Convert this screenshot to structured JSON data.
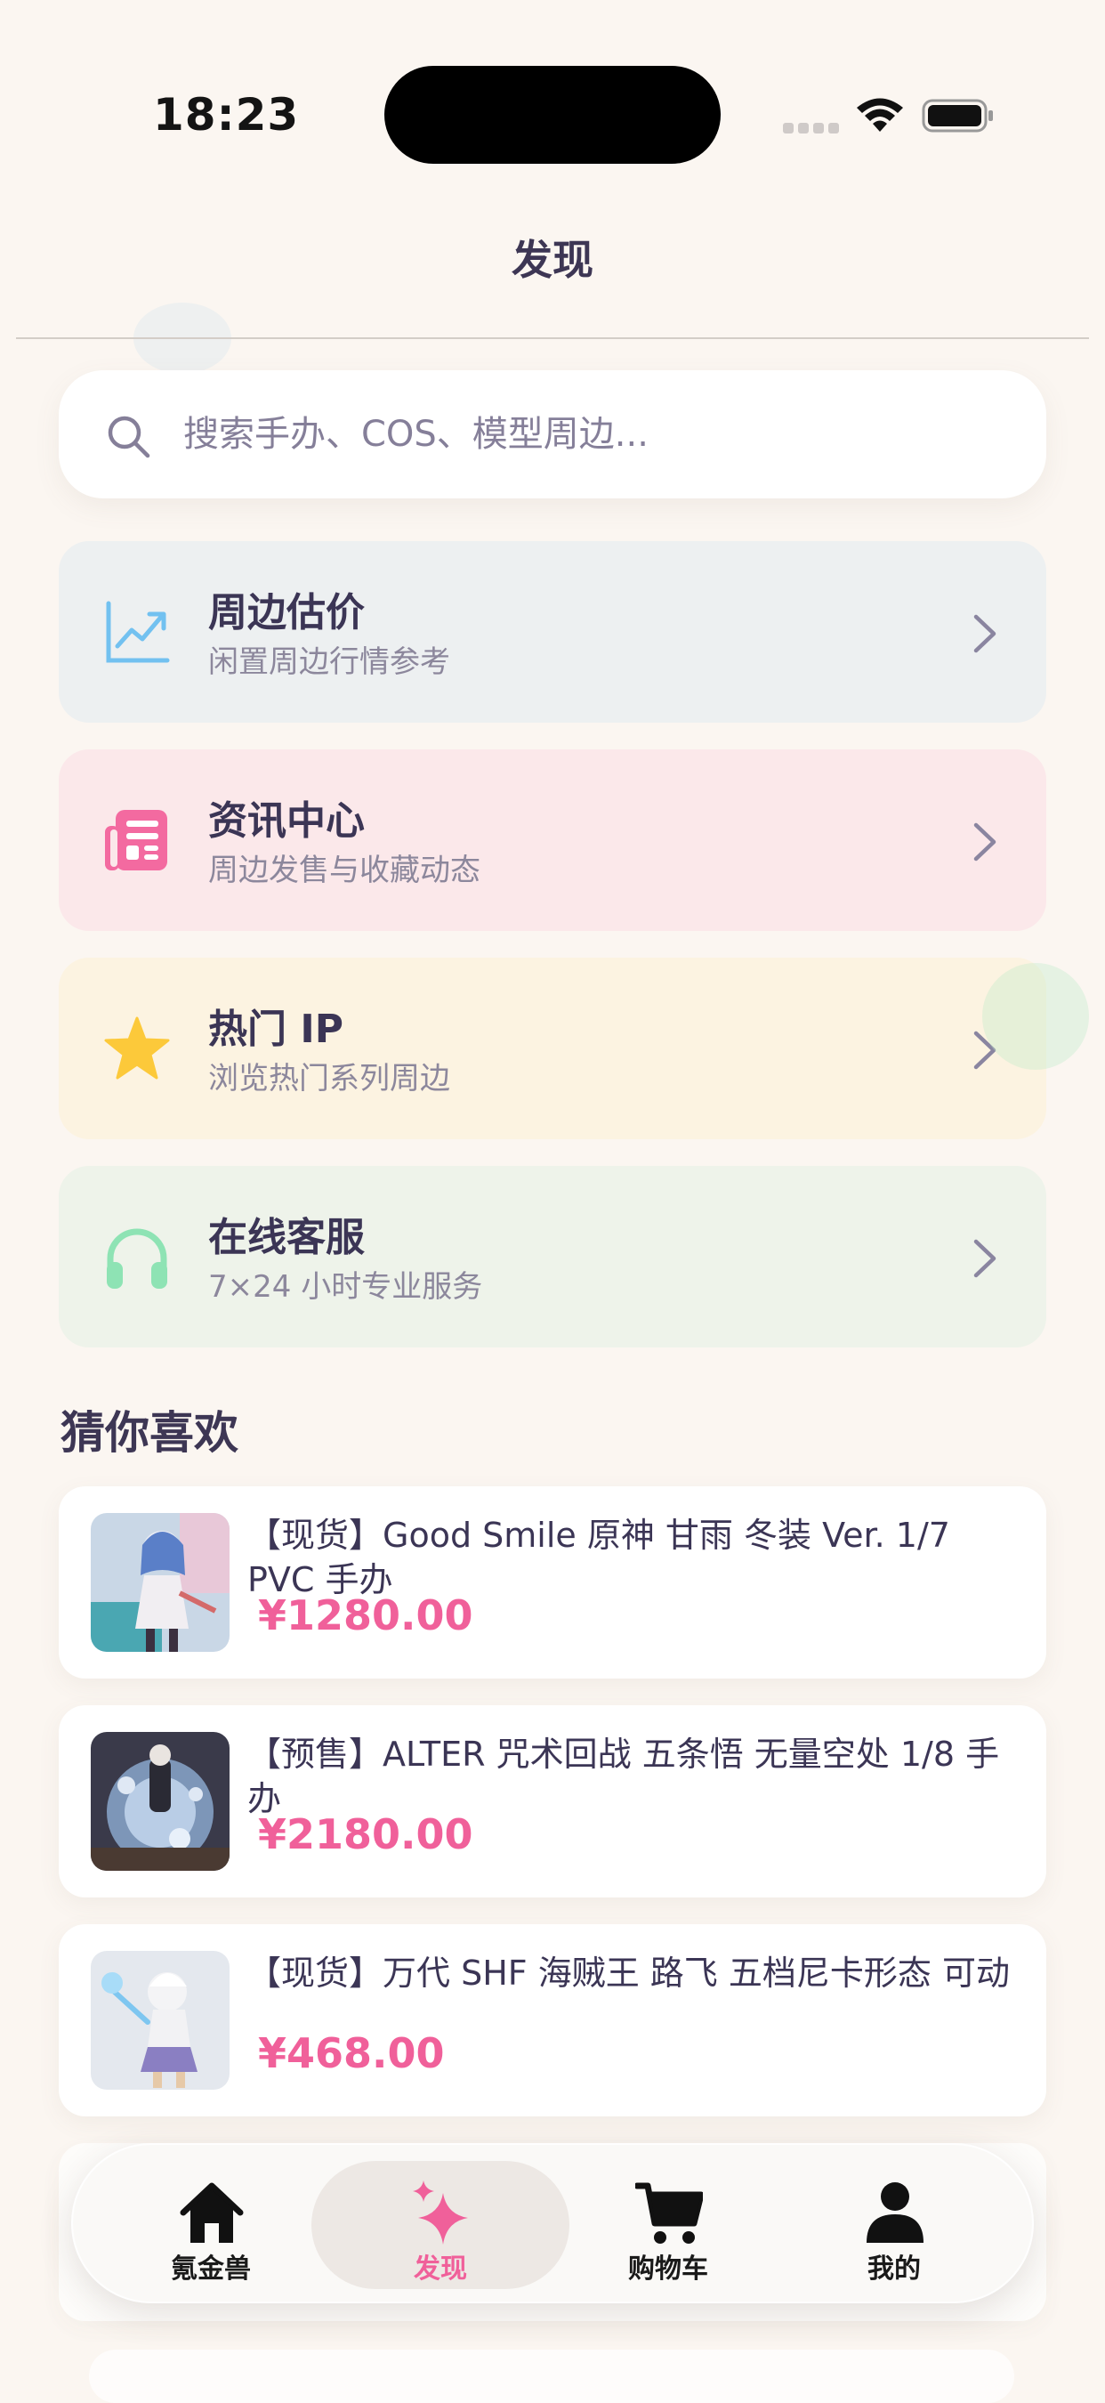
{
  "status_bar": {
    "time": "18:23"
  },
  "nav": {
    "title": "发现"
  },
  "search": {
    "placeholder": "搜索手办、COS、模型周边..."
  },
  "features": [
    {
      "title": "周边估价",
      "subtitle": "闲置周边行情参考",
      "icon": "chart-line-icon",
      "bg": "#edf0f1",
      "accent": "#72c1f0"
    },
    {
      "title": "资讯中心",
      "subtitle": "周边发售与收藏动态",
      "icon": "newspaper-icon",
      "bg": "#fbe8ea",
      "accent": "#f36aa0"
    },
    {
      "title": "热门 IP",
      "subtitle": "浏览热门系列周边",
      "icon": "star-icon",
      "bg": "#fcf3e1",
      "accent": "#fcc93a"
    },
    {
      "title": "在线客服",
      "subtitle": "7×24 小时专业服务",
      "icon": "headphones-icon",
      "bg": "#eef3ea",
      "accent": "#8ee3b4"
    }
  ],
  "recommend": {
    "title": "猜你喜欢",
    "items": [
      {
        "title": "【现货】Good Smile 原神 甘雨 冬装 Ver. 1/7 PVC 手办",
        "price": "¥1280.00"
      },
      {
        "title": "【预售】ALTER 咒术回战 五条悟 无量空处 1/8 手办",
        "price": "¥2180.00"
      },
      {
        "title": "【现货】万代 SHF 海贼王 路飞 五档尼卡形态 可动",
        "price": "¥468.00"
      }
    ]
  },
  "tabbar": {
    "items": [
      {
        "label": "氪金兽",
        "icon": "home-icon",
        "active": false
      },
      {
        "label": "发现",
        "icon": "sparkle-icon",
        "active": true
      },
      {
        "label": "购物车",
        "icon": "cart-icon",
        "active": false
      },
      {
        "label": "我的",
        "icon": "person-icon",
        "active": false
      }
    ],
    "active_color": "#f0609a"
  },
  "colors": {
    "price": "#f0609a",
    "background": "#fbf6f1"
  }
}
